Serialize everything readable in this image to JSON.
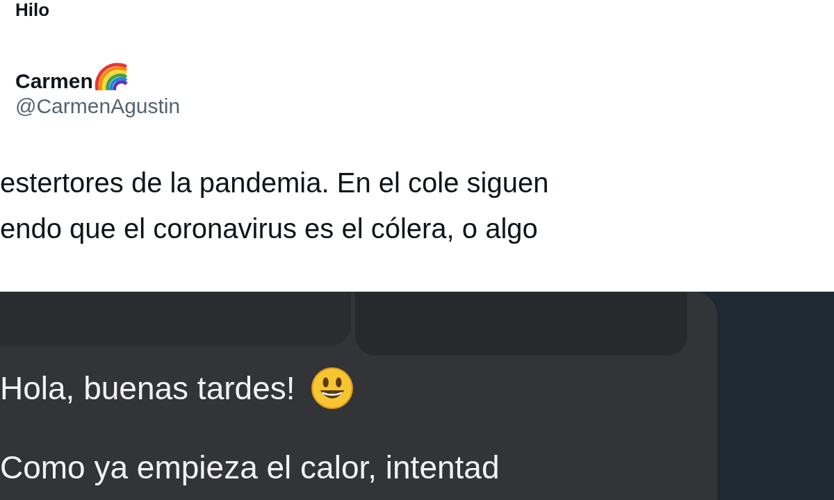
{
  "page": {
    "title": "Hilo"
  },
  "tweet": {
    "author": {
      "name": "Carmen",
      "handle": "@CarmenAgustin"
    },
    "text_lines": [
      "estertores de la pandemia. En el cole siguen",
      "endo que el coronavirus es el cólera, o algo"
    ]
  },
  "attached_image": {
    "messages": [
      "Hola, buenas tardes!",
      "Como ya empieza el calor, intentad"
    ]
  }
}
